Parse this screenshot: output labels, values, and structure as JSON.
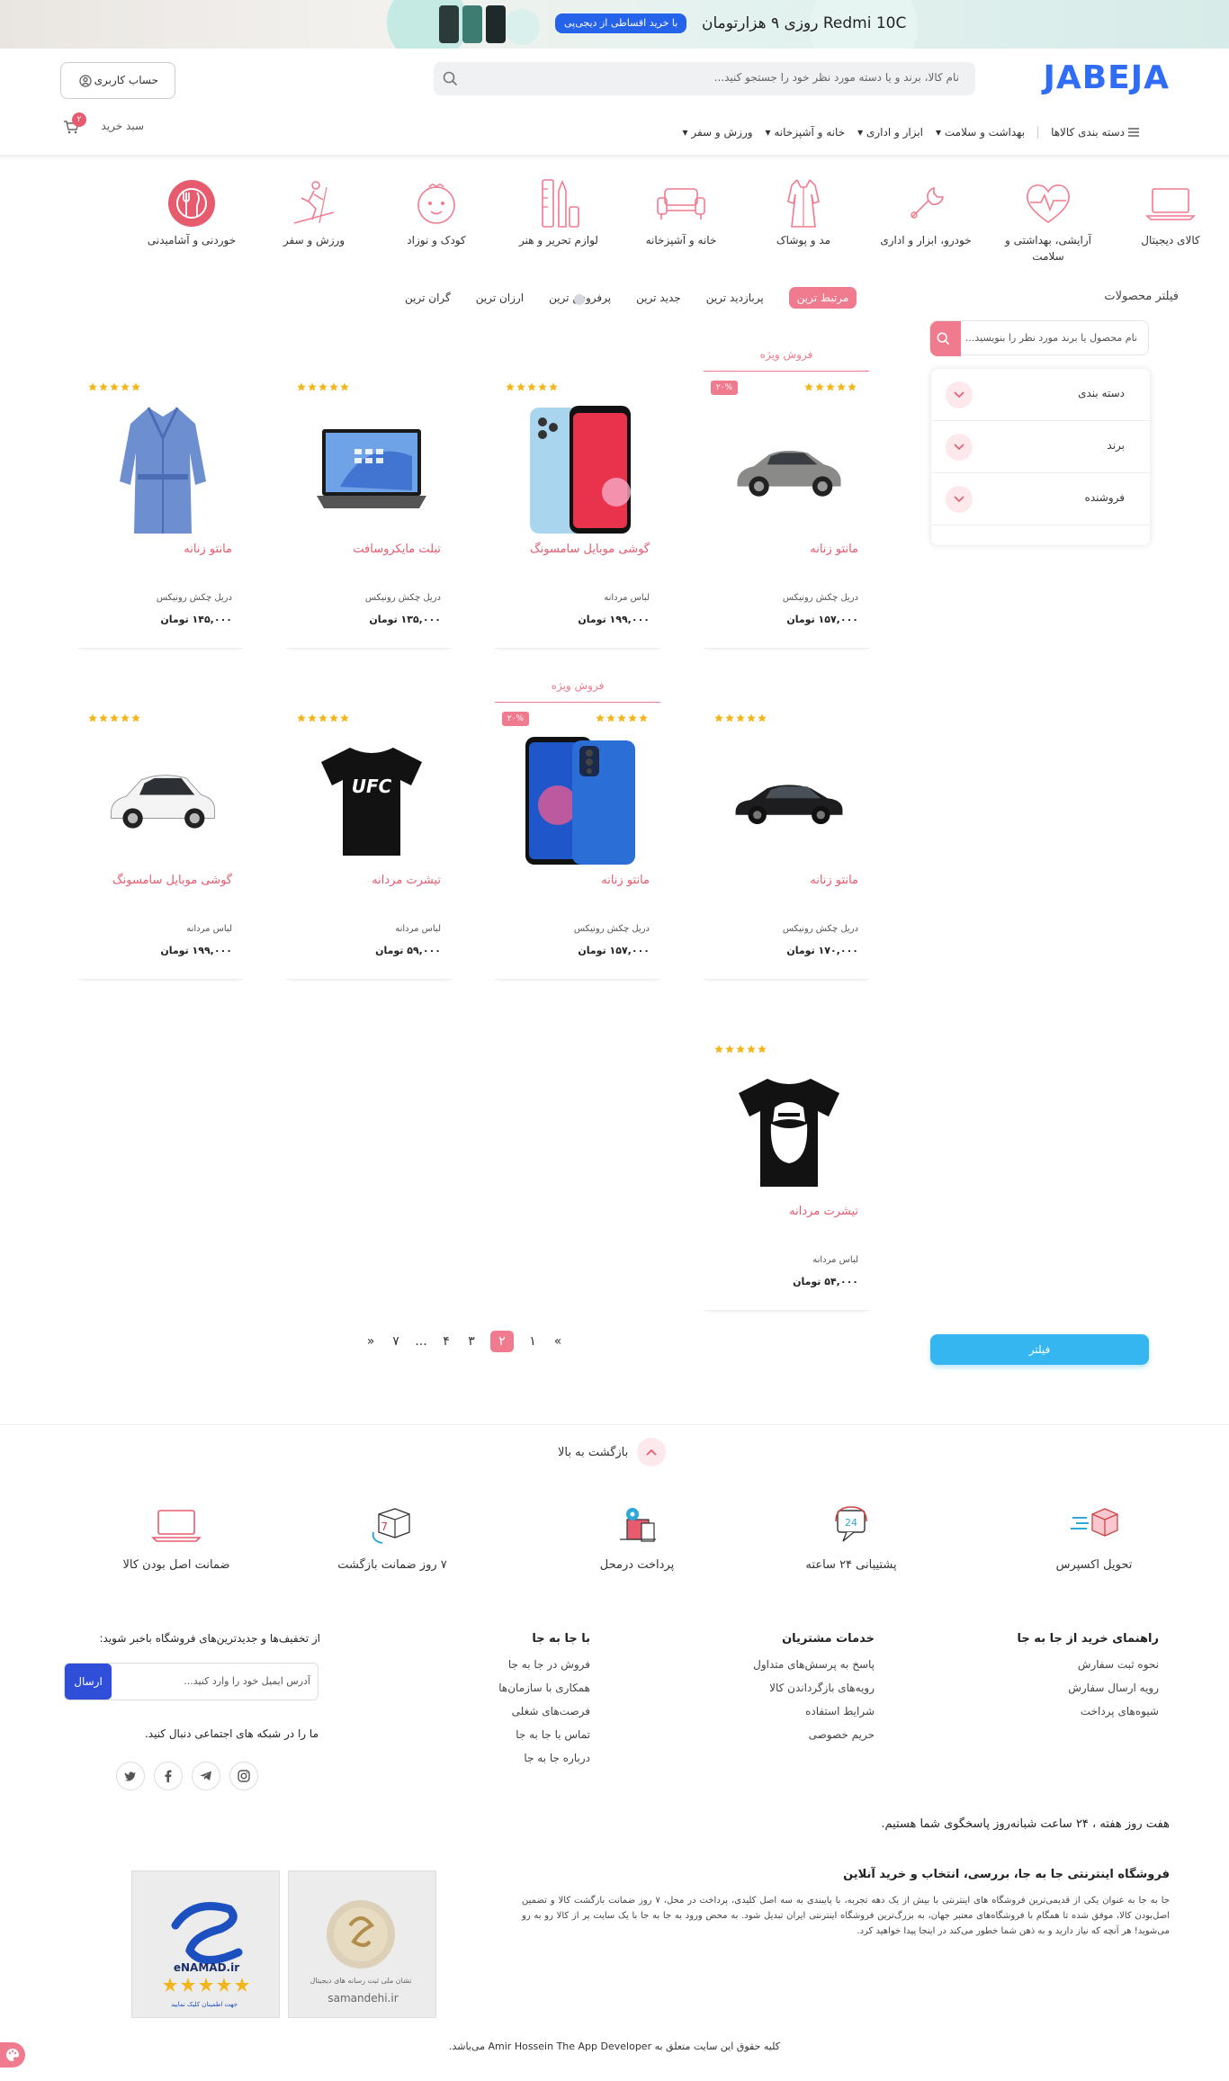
{
  "banner": {
    "title": "Redmi 10C روزی ۹ هزارتومان",
    "cta": "با خرید اقساطی از دیجی‌پی"
  },
  "header": {
    "logo": "JABEJA",
    "search_placeholder": "نام کالا، برند و یا دسته مورد نظر خود را جستجو کنید...",
    "account_label": "حساب کاربری",
    "cart_label": "سبد خرید",
    "cart_count": "۲",
    "nav": {
      "categories": "دسته بندی کالاها",
      "items": [
        "بهداشت و سلامت",
        "ابزار و اداری",
        "خانه و آشپزخانه",
        "ورزش و سفر"
      ]
    }
  },
  "categories": [
    {
      "label": "کالای دیجیتال",
      "icon": "laptop-icon"
    },
    {
      "label": "آرایشی، بهداشتی و سلامت",
      "icon": "heart-pulse-icon"
    },
    {
      "label": "خودرو، ابزار و اداری",
      "icon": "wrench-icon"
    },
    {
      "label": "مد و پوشاک",
      "icon": "dress-icon"
    },
    {
      "label": "خانه و آشپزخانه",
      "icon": "sofa-icon"
    },
    {
      "label": "لوازم تحریر و هنر",
      "icon": "stationery-icon"
    },
    {
      "label": "کودک و نوزاد",
      "icon": "baby-icon"
    },
    {
      "label": "ورزش و سفر",
      "icon": "skier-icon"
    },
    {
      "label": "خوردنی و آشامیدنی",
      "icon": "cutlery-icon"
    }
  ],
  "sort": {
    "items": [
      "مرتبط ترین",
      "پربازدید ترین",
      "جدید ترین",
      "پرفروش ترین",
      "ارزان ترین",
      "گران ترین"
    ],
    "active_index": 0
  },
  "filter": {
    "title": "فیلتر محصولات",
    "search_placeholder": "نام محصول یا برند مورد نظر را بنویسید...",
    "facets": [
      "دسته بندی",
      "برند",
      "فروشنده"
    ],
    "button": "فیلتر"
  },
  "special_label": "فروش ویژه",
  "discount_label": "۲۰%",
  "products": [
    {
      "title": "مانتو زنانه",
      "seller": "دریل چکش رونیکس",
      "price": "۱۵۷,۰۰۰ تومان",
      "image": "suv-car",
      "special": true
    },
    {
      "title": "گوشی موبایل سامسونگ",
      "seller": "لباس مردانه",
      "price": "۱۹۹,۰۰۰ تومان",
      "image": "phone-red",
      "special": false
    },
    {
      "title": "تبلت مایکروسافت",
      "seller": "دریل چکش رونیکس",
      "price": "۱۳۵,۰۰۰ تومان",
      "image": "surface-tablet",
      "special": false
    },
    {
      "title": "مانتو زنانه",
      "seller": "دریل چکش رونیکس",
      "price": "۱۴۵,۰۰۰ تومان",
      "image": "blue-coat",
      "special": false
    },
    {
      "title": "مانتو زنانه",
      "seller": "دریل چکش رونیکس",
      "price": "۱۷۰,۰۰۰ تومان",
      "image": "sedan-car",
      "special": false
    },
    {
      "title": "مانتو زنانه",
      "seller": "دریل چکش رونیکس",
      "price": "۱۵۷,۰۰۰ تومان",
      "image": "phone-blue",
      "special": true
    },
    {
      "title": "تیشرت مردانه",
      "seller": "لباس مردانه",
      "price": "۵۹,۰۰۰ تومان",
      "image": "ufc-tshirt",
      "special": false
    },
    {
      "title": "گوشی موبایل سامسونگ",
      "seller": "لباس مردانه",
      "price": "۱۹۹,۰۰۰ تومان",
      "image": "white-car",
      "special": false
    },
    {
      "title": "تیشرت مردانه",
      "seller": "لباس مردانه",
      "price": "۵۴,۰۰۰ تومان",
      "image": "beard-tshirt",
      "special": false
    }
  ],
  "pagination": {
    "prev": "«",
    "next": "»",
    "pages": [
      "۱",
      "۲",
      "۳",
      "۴",
      "...",
      "۷"
    ],
    "current_index": 1
  },
  "footer": {
    "back_to_top": "بازگشت به بالا",
    "features": [
      {
        "label": "تحویل اکسپرس",
        "icon": "express-delivery-icon"
      },
      {
        "label": "پشتیبانی ۲۴ ساعته",
        "icon": "support-24-icon"
      },
      {
        "label": "پرداخت درمحل",
        "icon": "cash-on-delivery-icon"
      },
      {
        "label": "۷ روز ضمانت بازگشت",
        "icon": "return-7-icon"
      },
      {
        "label": "ضمانت اصل بودن کالا",
        "icon": "original-laptop-icon"
      }
    ],
    "columns": [
      {
        "title": "راهنمای خرید از جا به جا",
        "links": [
          "نحوه ثبت سفارش",
          "رویه ارسال سفارش",
          "شیوه‌های پرداخت"
        ]
      },
      {
        "title": "خدمات مشتریان",
        "links": [
          "پاسخ به پرسش‌های متداول",
          "رویه‌های بازگرداندن کالا",
          "شرایط استفاده",
          "حریم خصوصی"
        ]
      },
      {
        "title": "با جا به جا",
        "links": [
          "فروش در جا به جا",
          "همکاری با سازمان‌ها",
          "فرصت‌های شغلی",
          "تماس با جا به جا",
          "درباره جا به جا"
        ]
      }
    ],
    "newsletter_title": "از تخفیف‌ها و جدیدترین‌های فروشگاه باخبر شوید:",
    "newsletter_placeholder": "آدرس ایمیل خود را وارد کنید...",
    "newsletter_button": "ارسال",
    "social_title": "ما را در شبکه های اجتماعی دنبال کنید.",
    "socials": [
      "instagram-icon",
      "telegram-icon",
      "facebook-icon",
      "twitter-icon"
    ],
    "support_text": "هفت روز هفته ، ۲۴ ساعت شبانه‌روز پاسخگوی شما هستیم.",
    "about_title": "فروشگاه اینترنتی جا به جا، بررسی، انتخاب و خرید آنلاین",
    "about_text": "جا به جا به عنوان یکی از قدیمی‌ترین فروشگاه های اینترنتی با بیش از یک دهه تجربه، با پایبندی به سه اصل کلیدی، پرداخت در محل، ۷ روز ضمانت بازگشت کالا و تضمین اصل‌بودن کالا، موفق شده تا همگام با فروشگاه‌های معتبر جهان، به بزرگ‌ترین فروشگاه اینترنتی ایران تبدیل شود. به محض ورود به جا به جا با یک سایت پر از کالا رو به رو می‌شوید! هر آنچه که نیاز دارید و به ذهن شما خطور می‌کند در اینجا پیدا خواهید کرد.",
    "seals": [
      {
        "name": "samandehi",
        "caption": "samandehi.ir"
      },
      {
        "name": "enamad",
        "caption": "eNAMAD.ir"
      }
    ],
    "copyright": "کلیه حقوق این سایت متعلق به Amir Hossein The App Developer می‌باشد."
  }
}
